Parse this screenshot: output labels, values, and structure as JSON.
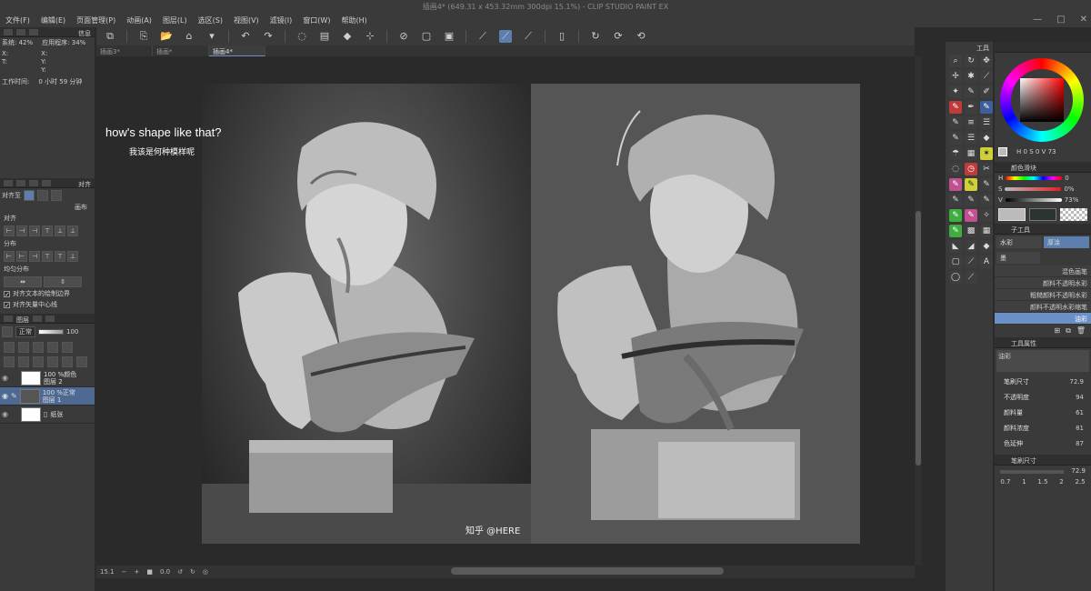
{
  "window": {
    "title": "插画4* (649.31 x 453.32mm 300dpi 15.1%)  - CLIP STUDIO PAINT EX"
  },
  "menu": [
    "文件(F)",
    "编辑(E)",
    "页面管理(P)",
    "动画(A)",
    "图层(L)",
    "选区(S)",
    "视图(V)",
    "滤镜(I)",
    "窗口(W)",
    "帮助(H)"
  ],
  "window_buttons": [
    "—",
    "□",
    "✕"
  ],
  "toolbar": {
    "icons": [
      "⧉",
      "⎘",
      "📂",
      "⌂",
      "▾",
      "↶",
      "↷",
      "◌",
      "▤",
      "◆",
      "⊹",
      "⊘",
      "▢",
      "▣",
      "⟋",
      "⟋",
      "⟋",
      "▯",
      "↻",
      "⟳",
      "⟲"
    ]
  },
  "doc_tabs": [
    "插画3*",
    "插画*",
    "插画4*"
  ],
  "left": {
    "info_tab": "信息",
    "system_label": "系统: 42%",
    "app_label": "应用程序: 34%",
    "x_label": "X:",
    "y_label": "Y:",
    "t_label": "T:",
    "x2_label": "X:",
    "y2_label": "Y:",
    "work_time_label": "工作时间:",
    "work_time_value": "0 小时 59 分钟",
    "align_tab": "对齐",
    "align_target": "对齐至",
    "canvas_label": "画布",
    "align_section": "对齐",
    "distribute_section": "分布",
    "equal_section": "均匀分布",
    "check1": "对齐文本的绘制边界",
    "check2": "对齐矢量中心线",
    "layer_tab": "图层",
    "blend_mode": "正常",
    "opacity": "100",
    "layers": [
      {
        "pct": "100 %颜色",
        "name": "图层 2"
      },
      {
        "pct": "100 %正常",
        "name": "图层 1"
      },
      {
        "pct": "",
        "name": "纸张"
      }
    ]
  },
  "canvas": {
    "overlay_en": "how's shape like that?",
    "overlay_cn": "我该是何种模样呢",
    "watermark": "知乎 @HERE"
  },
  "status": {
    "zoom": "15.1",
    "angle": "0.0"
  },
  "tools_header": "工具",
  "right": {
    "color_wheel_tab": "色环",
    "h_value": "0",
    "s_value": "0",
    "v_value": "73",
    "color_slider_tab": "颜色滑块",
    "slider_values": [
      "0",
      "0%",
      "73%"
    ],
    "subtool_tab": "子工具",
    "subtools": [
      "水彩",
      "厚涂",
      "墨"
    ],
    "brushes": [
      "混色画笔",
      "颜料不透明水彩",
      "粗糙颜料不透明水彩",
      "颜料不透明水彩缩笔",
      "油彩"
    ],
    "tool_props_tab": "工具属性",
    "tool_name": "油彩",
    "props": [
      {
        "label": "笔刷尺寸",
        "value": "72.9"
      },
      {
        "label": "不透明度",
        "value": "94"
      },
      {
        "label": "颜料量",
        "value": "61"
      },
      {
        "label": "颜料浓度",
        "value": "81"
      },
      {
        "label": "色延伸",
        "value": "87"
      }
    ],
    "brush_size_tab": "笔刷尺寸",
    "brush_size_value": "72.9",
    "size_presets": [
      "0.7",
      "1",
      "1.5",
      "2",
      "2.5"
    ]
  }
}
